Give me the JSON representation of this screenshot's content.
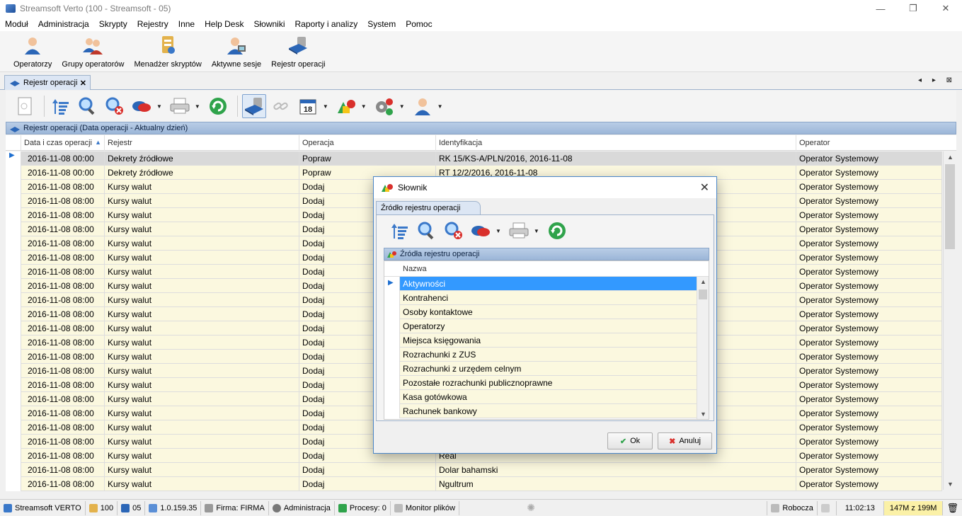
{
  "window": {
    "title": "Streamsoft Verto (100 - Streamsoft - 05)",
    "minimize": "—",
    "maximize": "❐",
    "close": "✕"
  },
  "menu": [
    "Moduł",
    "Administracja",
    "Skrypty",
    "Rejestry",
    "Inne",
    "Help Desk",
    "Słowniki",
    "Raporty i analizy",
    "System",
    "Pomoc"
  ],
  "ribbon": [
    {
      "label": "Operatorzy",
      "icon": "user-icon"
    },
    {
      "label": "Grupy operatorów",
      "icon": "users-group-icon"
    },
    {
      "label": "Menadżer skryptów",
      "icon": "scripts-manager-icon"
    },
    {
      "label": "Aktywne sesje",
      "icon": "active-sessions-icon"
    },
    {
      "label": "Rejestr operacji",
      "icon": "operations-register-icon"
    }
  ],
  "tab": {
    "label": "Rejestr operacji",
    "close": "✕",
    "nav": "◂ ▸ ⊠"
  },
  "grid": {
    "header": "Rejestr operacji (Data operacji - Aktualny dzień)",
    "columns": [
      "Data i czas operacji",
      "Rejestr",
      "Operacja",
      "Identyfikacja",
      "Operator"
    ],
    "rows": [
      [
        "2016-11-08 00:00",
        "Dekrety źródłowe",
        "Popraw",
        "RK 15/KS-A/PLN/2016, 2016-11-08",
        "Operator Systemowy"
      ],
      [
        "2016-11-08 00:00",
        "Dekrety źródłowe",
        "Popraw",
        "RT 12/2/2016, 2016-11-08",
        "Operator Systemowy"
      ],
      [
        "2016-11-08 08:00",
        "Kursy walut",
        "Dodaj",
        "",
        "Operator Systemowy"
      ],
      [
        "2016-11-08 08:00",
        "Kursy walut",
        "Dodaj",
        "",
        "Operator Systemowy"
      ],
      [
        "2016-11-08 08:00",
        "Kursy walut",
        "Dodaj",
        "",
        "Operator Systemowy"
      ],
      [
        "2016-11-08 08:00",
        "Kursy walut",
        "Dodaj",
        "",
        "Operator Systemowy"
      ],
      [
        "2016-11-08 08:00",
        "Kursy walut",
        "Dodaj",
        "",
        "Operator Systemowy"
      ],
      [
        "2016-11-08 08:00",
        "Kursy walut",
        "Dodaj",
        "",
        "Operator Systemowy"
      ],
      [
        "2016-11-08 08:00",
        "Kursy walut",
        "Dodaj",
        "",
        "Operator Systemowy"
      ],
      [
        "2016-11-08 08:00",
        "Kursy walut",
        "Dodaj",
        "",
        "Operator Systemowy"
      ],
      [
        "2016-11-08 08:00",
        "Kursy walut",
        "Dodaj",
        "",
        "Operator Systemowy"
      ],
      [
        "2016-11-08 08:00",
        "Kursy walut",
        "Dodaj",
        "",
        "Operator Systemowy"
      ],
      [
        "2016-11-08 08:00",
        "Kursy walut",
        "Dodaj",
        "",
        "Operator Systemowy"
      ],
      [
        "2016-11-08 08:00",
        "Kursy walut",
        "Dodaj",
        "",
        "Operator Systemowy"
      ],
      [
        "2016-11-08 08:00",
        "Kursy walut",
        "Dodaj",
        "",
        "Operator Systemowy"
      ],
      [
        "2016-11-08 08:00",
        "Kursy walut",
        "Dodaj",
        "",
        "Operator Systemowy"
      ],
      [
        "2016-11-08 08:00",
        "Kursy walut",
        "Dodaj",
        "",
        "Operator Systemowy"
      ],
      [
        "2016-11-08 08:00",
        "Kursy walut",
        "Dodaj",
        "",
        "Operator Systemowy"
      ],
      [
        "2016-11-08 08:00",
        "Kursy walut",
        "Dodaj",
        "",
        "Operator Systemowy"
      ],
      [
        "2016-11-08 08:00",
        "Kursy walut",
        "Dodaj",
        "",
        "Operator Systemowy"
      ],
      [
        "2016-11-08 08:00",
        "Kursy walut",
        "Dodaj",
        "",
        "Operator Systemowy"
      ],
      [
        "2016-11-08 08:00",
        "Kursy walut",
        "Dodaj",
        "Real",
        "Operator Systemowy"
      ],
      [
        "2016-11-08 08:00",
        "Kursy walut",
        "Dodaj",
        "Dolar bahamski",
        "Operator Systemowy"
      ],
      [
        "2016-11-08 08:00",
        "Kursy walut",
        "Dodaj",
        "Ngultrum",
        "Operator Systemowy"
      ]
    ]
  },
  "dialog": {
    "title": "Słownik",
    "close": "✕",
    "tab": "Źródło rejestru operacji",
    "grid_header": "Źródła rejestru operacji",
    "column": "Nazwa",
    "items": [
      "Aktywności",
      "Kontrahenci",
      "Osoby kontaktowe",
      "Operatorzy",
      "Miejsca księgowania",
      "Rozrachunki z ZUS",
      "Rozrachunki z urzędem celnym",
      "Pozostałe rozrachunki publicznoprawne",
      "Kasa gotówkowa",
      "Rachunek bankowy"
    ],
    "ok": "Ok",
    "cancel": "Anuluj"
  },
  "status": {
    "app": "Streamsoft VERTO",
    "company_no": "100",
    "db": "05",
    "version": "1.0.159.35",
    "firm": "Firma: FIRMA",
    "module": "Administracja",
    "processes": "Procesy: 0",
    "monitor": "Monitor plików",
    "workday": "Robocza",
    "time": "11:02:13",
    "memory": "147M z 199M"
  },
  "colors": {
    "accent": "#3399ff",
    "row_bg": "#fbf8df",
    "header": "#9cb6d8"
  }
}
